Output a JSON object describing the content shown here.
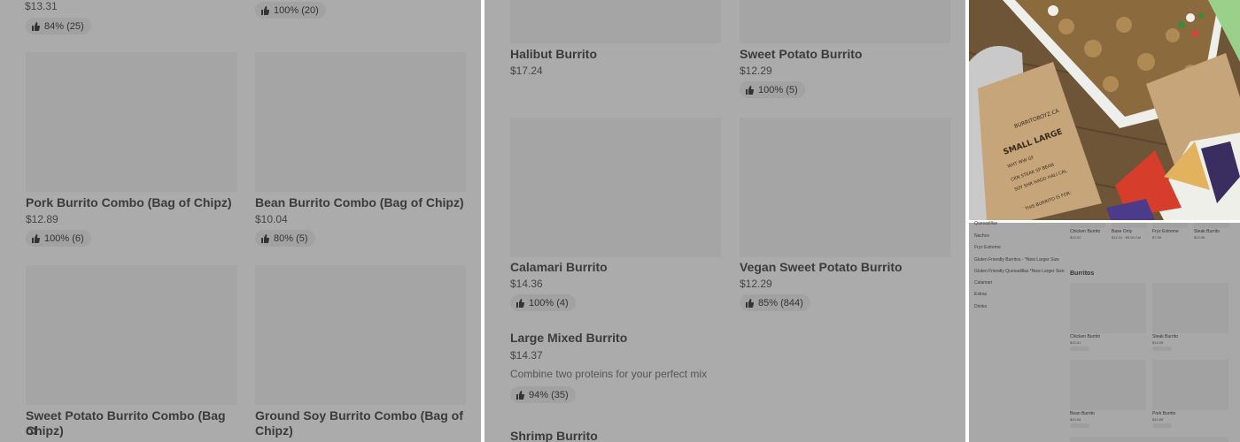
{
  "panel1": {
    "top_price": "$13.31",
    "top_rating_left": "84% (25)",
    "top_rating_right": "100% (20)",
    "items": [
      {
        "name": "Pork Burrito Combo (Bag of Chipz)",
        "price": "$12.89",
        "rating": "100% (6)"
      },
      {
        "name": "Bean Burrito Combo (Bag of Chipz)",
        "price": "$10.04",
        "rating": "80% (5)"
      },
      {
        "name_line1": "Sweet Potato Burrito Combo (Bag of",
        "name_line2": "Chipz)"
      },
      {
        "name_line1": "Ground Soy Burrito Combo (Bag of",
        "name_line2": "Chipz)"
      }
    ]
  },
  "panel2": {
    "items": [
      {
        "name": "Halibut Burrito",
        "price": "$17.24"
      },
      {
        "name": "Sweet Potato Burrito",
        "price": "$12.29",
        "rating": "100% (5)"
      },
      {
        "name": "Calamari Burrito",
        "price": "$14.36",
        "rating": "100% (4)"
      },
      {
        "name": "Vegan Sweet Potato Burrito",
        "price": "$12.29",
        "rating": "85% (844)"
      },
      {
        "name": "Large Mixed Burrito",
        "price": "$14.37",
        "description": "Combine two proteins for your perfect mix",
        "rating": "94% (35)"
      },
      {
        "name": "Shrimp Burrito"
      }
    ]
  },
  "panel3": {
    "photo_text": {
      "brand": "BURRITOBOYZ.CA",
      "sizes": "SMALL LARGE",
      "options": "WHT WW GF",
      "proteins": "CKN STEAK SP BEAN",
      "proteins2": "SOY SHR HADD HALI CAL",
      "footer": "THIS BURRITO IS FOR:"
    },
    "mini": {
      "nav": [
        "Quesadillas",
        "Nachos",
        "Fryz Extreme",
        "Gluten Friendly Burritos - *New Larger Size",
        "Gluten Friendly Quesadillas *New Larger Size",
        "Calamari",
        "Extras",
        "Drinks"
      ],
      "top_labels": [
        "Chicken Burrito",
        "Base Only",
        "Fryz Extreme",
        "Steak Burrito"
      ],
      "top_prices": [
        "$13.31",
        "$12.31 · $9.50 Cal",
        "$7.59",
        "$13.99"
      ],
      "section_title": "Burritos",
      "grid": [
        {
          "name": "Chicken Burrito",
          "price": "$13.31"
        },
        {
          "name": "Steak Burrito",
          "price": "$13.99"
        },
        {
          "name": "Bean Burrito",
          "price": "$10.04"
        },
        {
          "name": "Pork Burrito",
          "price": "$12.89"
        }
      ]
    }
  },
  "colors": {
    "overlay": "#ababab",
    "placeholder": "#a5a5a5",
    "pill": "#a2a2a2"
  }
}
